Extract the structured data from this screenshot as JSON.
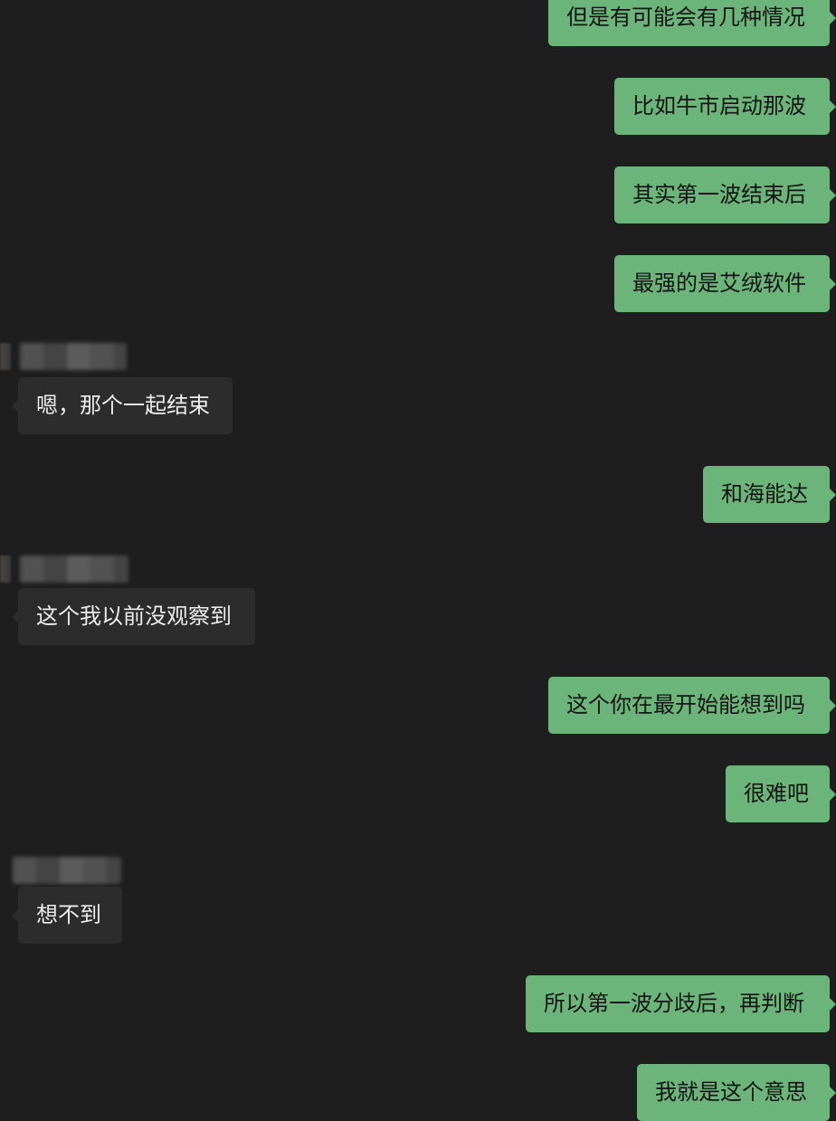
{
  "colors": {
    "background": "#1e1e1e",
    "outgoing_bubble": "#6bb57a",
    "incoming_bubble": "#2c2c2c"
  },
  "messages": [
    {
      "id": "m1",
      "direction": "outgoing",
      "text": "但是有可能会有几种情况"
    },
    {
      "id": "m2",
      "direction": "outgoing",
      "text": "比如牛市启动那波"
    },
    {
      "id": "m3",
      "direction": "outgoing",
      "text": "其实第一波结束后"
    },
    {
      "id": "m4",
      "direction": "outgoing",
      "text": "最强的是艾绒软件"
    },
    {
      "id": "m5",
      "direction": "incoming",
      "text": "嗯，那个一起结束"
    },
    {
      "id": "m6",
      "direction": "outgoing",
      "text": "和海能达"
    },
    {
      "id": "m7",
      "direction": "incoming",
      "text": "这个我以前没观察到"
    },
    {
      "id": "m8",
      "direction": "outgoing",
      "text": "这个你在最开始能想到吗"
    },
    {
      "id": "m9",
      "direction": "outgoing",
      "text": "很难吧"
    },
    {
      "id": "m10",
      "direction": "incoming",
      "text": "想不到"
    },
    {
      "id": "m11",
      "direction": "outgoing",
      "text": "所以第一波分歧后，再判断"
    },
    {
      "id": "m12",
      "direction": "outgoing",
      "text": "我就是这个意思"
    }
  ]
}
